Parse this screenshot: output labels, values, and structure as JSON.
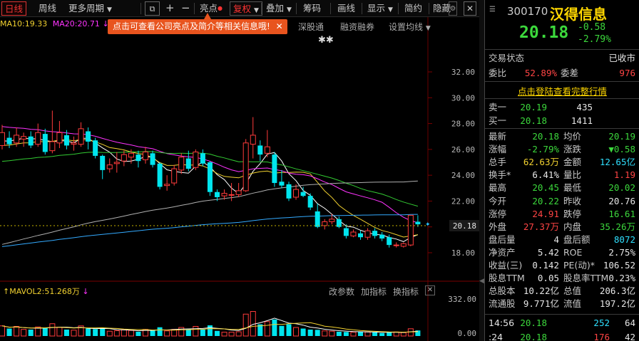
{
  "toolbar": {
    "items": [
      "日线",
      "周线",
      "更多周期",
      "亮点",
      "复权",
      "叠加",
      "筹码",
      "画线",
      "显示",
      "简约",
      "隐藏"
    ],
    "icon_buttons": [
      "restore-icon",
      "plus-icon",
      "minus-icon",
      "settings-icon",
      "close-icon"
    ]
  },
  "chart": {
    "ma_legend": {
      "ma10": "MA10:19.33",
      "ma20": "MA20:20.71"
    },
    "tooltip": "点击可查看公司亮点及简介等相关信息哦!",
    "tabs": [
      "深股通",
      "融资融券",
      "设置均线"
    ],
    "y_labels": [
      "32.00",
      "30.00",
      "28.00",
      "26.00",
      "24.00",
      "22.00",
      "20.00",
      "18.00"
    ],
    "current_price_tag": "20.18",
    "vol_legend": "MAVOL2:51.268万",
    "vol_buttons": [
      "改参数",
      "加指标",
      "换指标"
    ],
    "vol_labels": [
      "332.00",
      "0.00"
    ],
    "colors": {
      "up": "#ff3b3b",
      "down": "#00e5ee",
      "ma5": "#ffffff",
      "ma10": "#f2d230",
      "ma20": "#ff33ff",
      "ma30": "#33cc33",
      "ma60": "#b0b0b0",
      "ma120": "#33aaff"
    }
  },
  "chart_data": {
    "type": "candlestick",
    "ylim": [
      18,
      33
    ],
    "candles": [
      {
        "o": 26.3,
        "c": 27.3,
        "h": 27.9,
        "l": 26.0
      },
      {
        "o": 26.9,
        "c": 26.4,
        "h": 27.4,
        "l": 26.1
      },
      {
        "o": 26.5,
        "c": 27.1,
        "h": 27.7,
        "l": 26.2
      },
      {
        "o": 26.8,
        "c": 27.0,
        "h": 27.3,
        "l": 26.2
      },
      {
        "o": 27.0,
        "c": 26.3,
        "h": 27.4,
        "l": 26.1
      },
      {
        "o": 26.4,
        "c": 27.3,
        "h": 28.0,
        "l": 26.2
      },
      {
        "o": 27.2,
        "c": 25.8,
        "h": 27.6,
        "l": 25.6
      },
      {
        "o": 25.9,
        "c": 26.6,
        "h": 29.0,
        "l": 25.7
      },
      {
        "o": 26.5,
        "c": 27.3,
        "h": 28.2,
        "l": 26.1
      },
      {
        "o": 27.1,
        "c": 26.3,
        "h": 27.5,
        "l": 26.0
      },
      {
        "o": 26.4,
        "c": 26.5,
        "h": 27.0,
        "l": 25.9
      },
      {
        "o": 26.4,
        "c": 27.6,
        "h": 28.1,
        "l": 26.2
      },
      {
        "o": 27.4,
        "c": 26.6,
        "h": 27.7,
        "l": 26.0
      },
      {
        "o": 26.7,
        "c": 25.5,
        "h": 26.9,
        "l": 25.3
      },
      {
        "o": 25.5,
        "c": 24.4,
        "h": 25.6,
        "l": 23.7
      },
      {
        "o": 24.5,
        "c": 24.8,
        "h": 25.3,
        "l": 24.2
      },
      {
        "o": 24.9,
        "c": 25.0,
        "h": 25.8,
        "l": 24.2
      },
      {
        "o": 25.1,
        "c": 25.6,
        "h": 25.9,
        "l": 24.7
      },
      {
        "o": 25.4,
        "c": 25.7,
        "h": 26.0,
        "l": 24.9
      },
      {
        "o": 25.6,
        "c": 25.1,
        "h": 25.9,
        "l": 24.6
      },
      {
        "o": 25.2,
        "c": 25.8,
        "h": 26.2,
        "l": 24.9
      },
      {
        "o": 25.7,
        "c": 24.8,
        "h": 25.9,
        "l": 24.6
      },
      {
        "o": 24.9,
        "c": 23.1,
        "h": 25.0,
        "l": 22.9
      },
      {
        "o": 23.2,
        "c": 23.3,
        "h": 24.0,
        "l": 22.8
      },
      {
        "o": 23.4,
        "c": 24.5,
        "h": 24.8,
        "l": 23.2
      },
      {
        "o": 24.4,
        "c": 25.4,
        "h": 25.7,
        "l": 24.1
      },
      {
        "o": 25.3,
        "c": 24.5,
        "h": 25.9,
        "l": 24.3
      },
      {
        "o": 24.6,
        "c": 25.8,
        "h": 26.0,
        "l": 24.4
      },
      {
        "o": 25.7,
        "c": 24.9,
        "h": 26.0,
        "l": 24.7
      },
      {
        "o": 25.0,
        "c": 22.7,
        "h": 25.1,
        "l": 22.4
      },
      {
        "o": 22.7,
        "c": 22.3,
        "h": 22.9,
        "l": 22.0
      },
      {
        "o": 22.4,
        "c": 22.6,
        "h": 22.9,
        "l": 22.1
      },
      {
        "o": 22.5,
        "c": 22.5,
        "h": 23.4,
        "l": 22.0
      },
      {
        "o": 22.5,
        "c": 22.8,
        "h": 23.4,
        "l": 22.3
      },
      {
        "o": 22.8,
        "c": 26.5,
        "h": 26.8,
        "l": 22.7
      },
      {
        "o": 26.4,
        "c": 27.1,
        "h": 28.5,
        "l": 25.3
      },
      {
        "o": 26.3,
        "c": 25.6,
        "h": 26.7,
        "l": 25.1
      },
      {
        "o": 25.7,
        "c": 26.2,
        "h": 27.5,
        "l": 25.4
      },
      {
        "o": 25.6,
        "c": 23.4,
        "h": 25.8,
        "l": 23.1
      },
      {
        "o": 23.5,
        "c": 23.2,
        "h": 24.4,
        "l": 23.0
      },
      {
        "o": 23.3,
        "c": 22.2,
        "h": 23.5,
        "l": 22.0
      },
      {
        "o": 22.3,
        "c": 22.9,
        "h": 23.3,
        "l": 22.1
      },
      {
        "o": 22.7,
        "c": 22.4,
        "h": 23.1,
        "l": 22.3
      },
      {
        "o": 22.4,
        "c": 21.5,
        "h": 22.6,
        "l": 21.3
      },
      {
        "o": 21.2,
        "c": 20.0,
        "h": 21.8,
        "l": 19.9
      },
      {
        "o": 20.1,
        "c": 20.4,
        "h": 20.6,
        "l": 19.8
      },
      {
        "o": 20.4,
        "c": 20.6,
        "h": 21.0,
        "l": 20.2
      },
      {
        "o": 20.6,
        "c": 20.0,
        "h": 20.8,
        "l": 19.9
      },
      {
        "o": 19.9,
        "c": 19.3,
        "h": 20.2,
        "l": 19.1
      },
      {
        "o": 19.3,
        "c": 19.6,
        "h": 19.8,
        "l": 19.2
      },
      {
        "o": 19.5,
        "c": 19.2,
        "h": 19.7,
        "l": 19.0
      },
      {
        "o": 19.2,
        "c": 19.7,
        "h": 19.9,
        "l": 19.0
      },
      {
        "o": 19.7,
        "c": 19.3,
        "h": 19.9,
        "l": 19.1
      },
      {
        "o": 19.4,
        "c": 19.1,
        "h": 19.6,
        "l": 18.9
      },
      {
        "o": 19.2,
        "c": 18.6,
        "h": 19.4,
        "l": 18.4
      },
      {
        "o": 18.6,
        "c": 18.6,
        "h": 18.8,
        "l": 18.4
      },
      {
        "o": 18.5,
        "c": 18.7,
        "h": 18.8,
        "l": 18.4
      },
      {
        "o": 18.6,
        "c": 20.9,
        "h": 20.9,
        "l": 18.5
      },
      {
        "o": 20.4,
        "c": 20.2,
        "h": 20.9,
        "l": 20.0
      }
    ],
    "volume": [
      95,
      70,
      90,
      62,
      60,
      85,
      75,
      115,
      82,
      60,
      55,
      95,
      70,
      65,
      70,
      45,
      50,
      58,
      52,
      40,
      62,
      50,
      82,
      48,
      62,
      80,
      62,
      90,
      60,
      100,
      48,
      36,
      36,
      40,
      205,
      230,
      110,
      135,
      155,
      95,
      110,
      80,
      70,
      60,
      58,
      48,
      45,
      40,
      38,
      36,
      42,
      38,
      34,
      28,
      34,
      38,
      32,
      68,
      52
    ],
    "vol_ylim": [
      0,
      360
    ]
  },
  "panel": {
    "code": "300170",
    "name": "汉得信息",
    "price": "20.18",
    "change": "-0.58",
    "change_pct": "-2.79%",
    "status_label": "交易状态",
    "status_value": "已收市",
    "weibi_label": "委比",
    "weibi_value": "52.89%",
    "weicha_label": "委差",
    "weicha_value": "976",
    "login_link": "点击登陆查看完整行情",
    "orders": [
      {
        "label": "卖一",
        "price": "20.19",
        "vol": "435"
      },
      {
        "label": "买一",
        "price": "20.18",
        "vol": "1411"
      }
    ],
    "stats": [
      {
        "l1": "最新",
        "v1": "20.18",
        "c1": "g",
        "l2": "均价",
        "v2": "20.19",
        "c2": "g"
      },
      {
        "l1": "涨幅",
        "v1": "-2.79%",
        "c1": "g",
        "l2": "涨跌",
        "v2": "▼0.58",
        "c2": "g"
      },
      {
        "l1": "总手",
        "v1": "62.63万",
        "c1": "y",
        "l2": "金额",
        "v2": "12.65亿",
        "c2": "cy"
      },
      {
        "l1": "换手*",
        "v1": "6.41%",
        "c1": "w",
        "l2": "量比",
        "v2": "1.19",
        "c2": "r"
      },
      {
        "l1": "最高",
        "v1": "20.45",
        "c1": "g",
        "l2": "最低",
        "v2": "20.02",
        "c2": "g"
      },
      {
        "l1": "今开",
        "v1": "20.22",
        "c1": "g",
        "l2": "昨收",
        "v2": "20.76",
        "c2": "w"
      },
      {
        "l1": "涨停",
        "v1": "24.91",
        "c1": "r",
        "l2": "跌停",
        "v2": "16.61",
        "c2": "g"
      },
      {
        "l1": "外盘",
        "v1": "27.37万",
        "c1": "r",
        "l2": "内盘",
        "v2": "35.26万",
        "c2": "g"
      },
      {
        "l1": "盘后量",
        "v1": "4",
        "c1": "w",
        "l2": "盘后额",
        "v2": "8072",
        "c2": "cy"
      },
      {
        "l1": "净资产",
        "v1": "5.42",
        "c1": "w",
        "l2": "ROE",
        "v2": "2.75%",
        "c2": "w"
      },
      {
        "l1": "收益(三)",
        "v1": "0.142",
        "c1": "w",
        "l2": "PE(动)*",
        "v2": "106.52",
        "c2": "w"
      },
      {
        "l1": "股息TTM",
        "v1": "0.05",
        "c1": "w",
        "l2": "股息率TTM",
        "v2": "0.23%",
        "c2": "w"
      },
      {
        "l1": "总股本",
        "v1": "10.22亿",
        "c1": "w",
        "l2": "总值",
        "v2": "206.3亿",
        "c2": "w"
      },
      {
        "l1": "流通股",
        "v1": "9.771亿",
        "c1": "w",
        "l2": "流值",
        "v2": "197.2亿",
        "c2": "w"
      }
    ],
    "ticks": [
      {
        "time": "14:56",
        "price": "20.18",
        "vol": "252",
        "num": "64",
        "vc": "cy"
      },
      {
        "time": ":24",
        "price": "20.18",
        "vol": "176",
        "num": "42",
        "vc": "r"
      }
    ]
  }
}
